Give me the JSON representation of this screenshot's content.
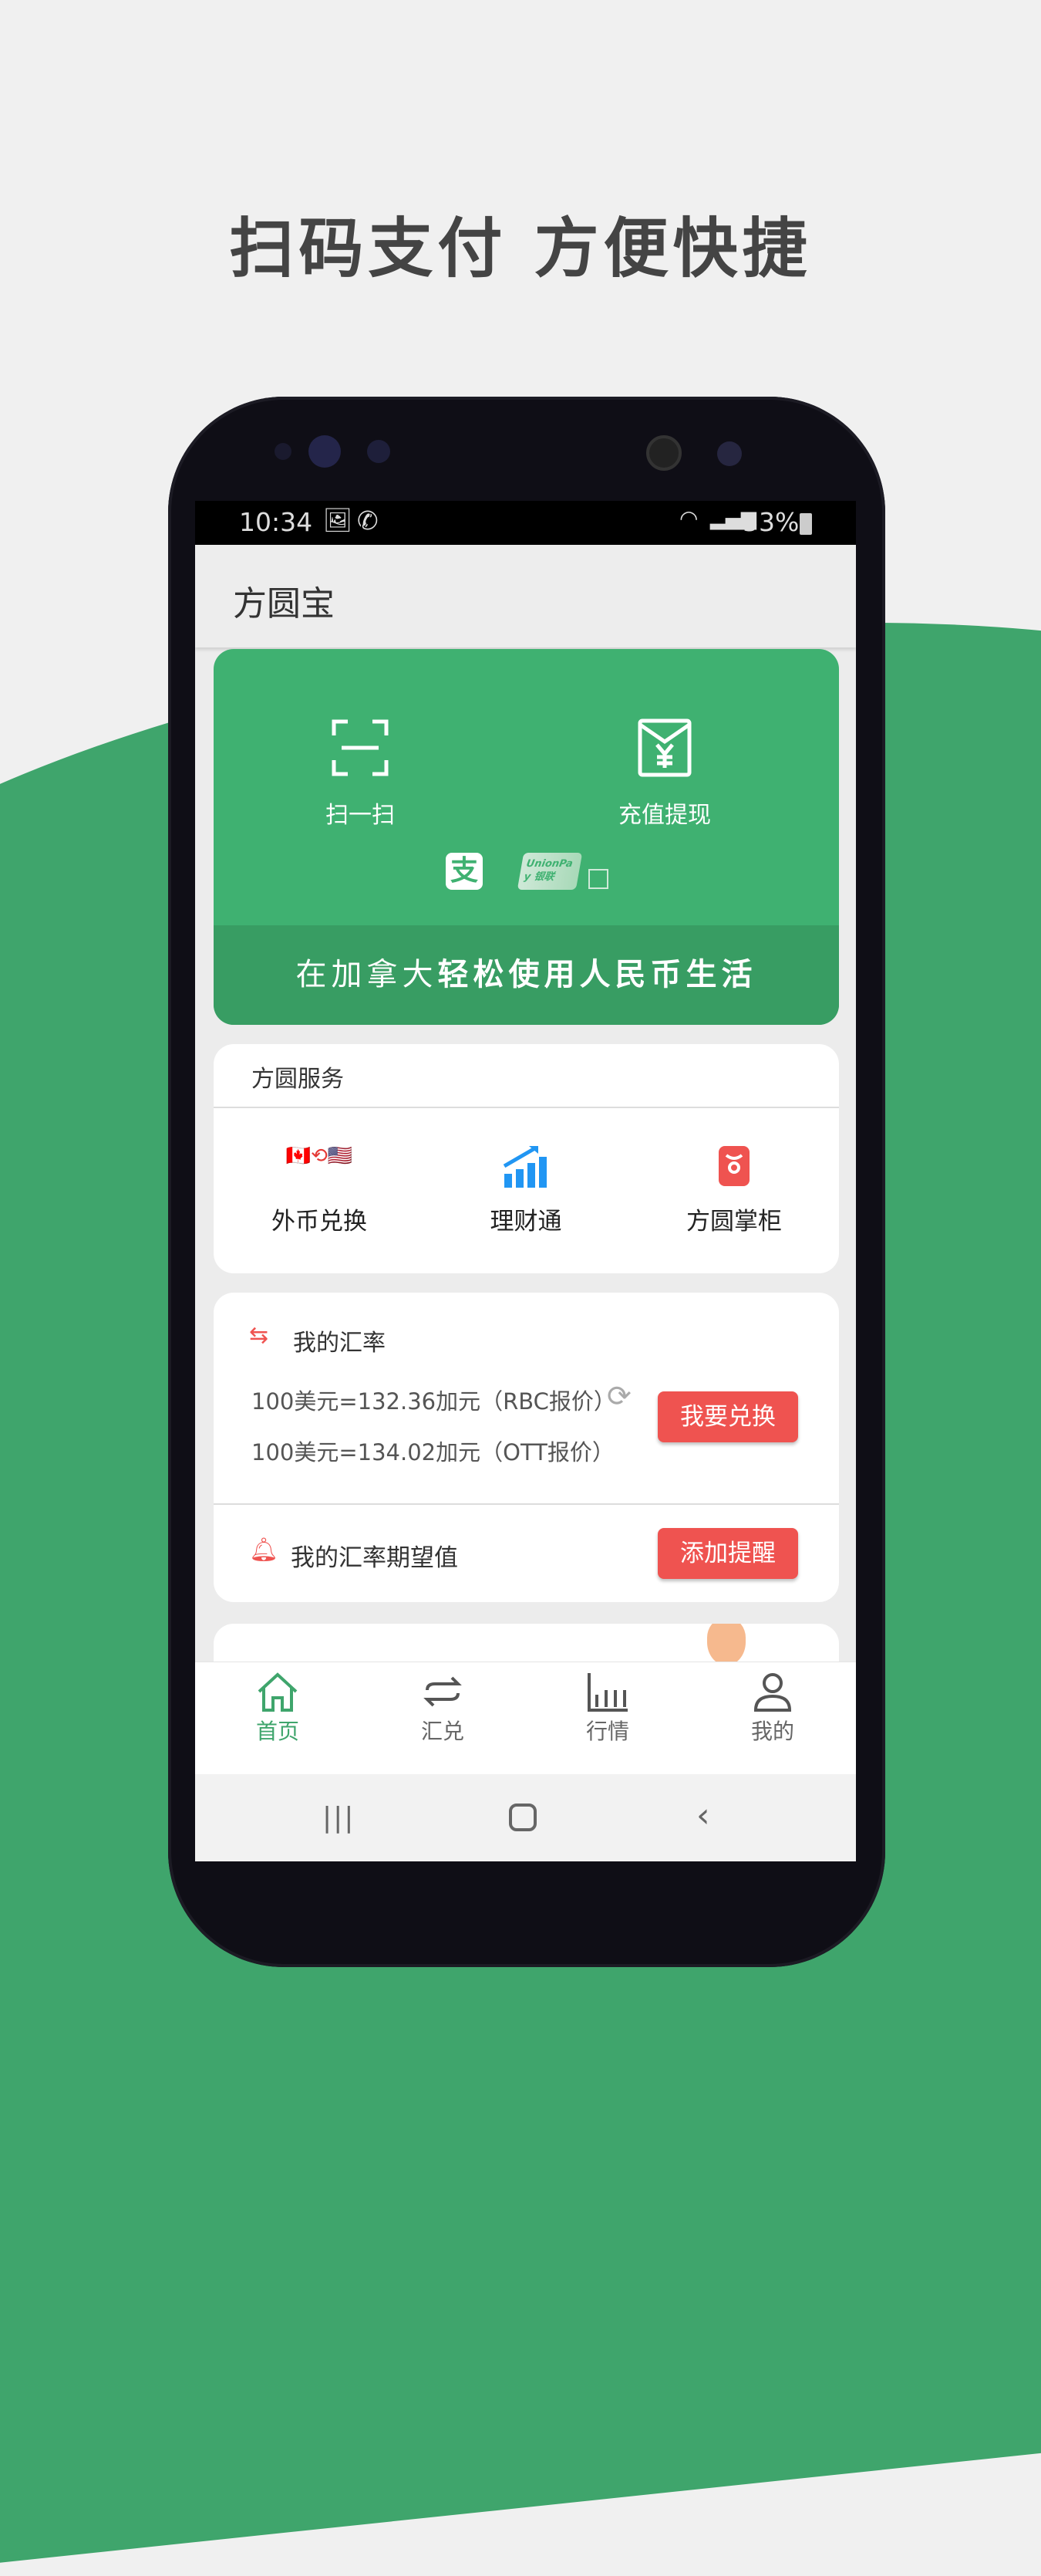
{
  "headline": "扫码支付  方便快捷",
  "status": {
    "time": "10:34",
    "battery": "53%"
  },
  "app": {
    "title": "方圆宝"
  },
  "banner": {
    "scan": "扫一扫",
    "topup": "充值提现",
    "slogan_light": "在加拿大",
    "slogan_bold": "轻松使用人民币生活",
    "unionpay": "UnionPay 银联"
  },
  "services": {
    "title": "方圆服务",
    "items": [
      {
        "label": "外币兑换",
        "icon": "currency-exchange-icon"
      },
      {
        "label": "理财通",
        "icon": "bar-chart-growth-icon"
      },
      {
        "label": "方圆掌柜",
        "icon": "red-wallet-icon"
      }
    ]
  },
  "rates": {
    "title": "我的汇率",
    "rbc": "100美元=132.36加元（RBC报价）",
    "ott": "100美元=134.02加元（OTT报价）",
    "exchange_button": "我要兑换",
    "expect_title": "我的汇率期望值",
    "remind_button": "添加提醒"
  },
  "nav": [
    {
      "label": "首页",
      "active": true
    },
    {
      "label": "汇兑"
    },
    {
      "label": "行情"
    },
    {
      "label": "我的"
    }
  ],
  "colors": {
    "brand_green": "#3fb171",
    "accent_red": "#ef5350",
    "background_green": "#3fa56c"
  }
}
